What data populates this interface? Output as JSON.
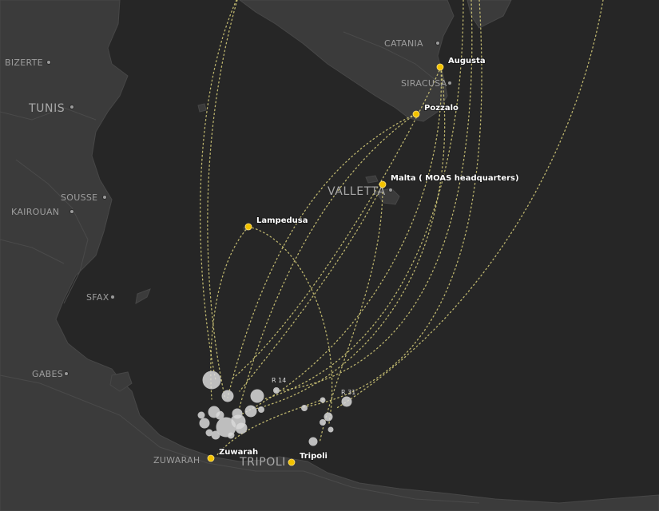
{
  "city_labels": [
    {
      "id": "bizerte",
      "text": "BIZERTE"
    },
    {
      "id": "tunis",
      "text": "TUNIS"
    },
    {
      "id": "sousse",
      "text": "SOUSSE"
    },
    {
      "id": "kairouan",
      "text": "KAIROUAN"
    },
    {
      "id": "sfax",
      "text": "SFAX"
    },
    {
      "id": "gabes",
      "text": "GABES"
    },
    {
      "id": "zuwarah",
      "text": "ZUWARAH"
    },
    {
      "id": "tripoli",
      "text": "TRIPOLI"
    },
    {
      "id": "catania",
      "text": "CATANIA"
    },
    {
      "id": "siracusa",
      "text": "SIRACUSA"
    },
    {
      "id": "valletta",
      "text": "VALLETTA"
    }
  ],
  "ports": [
    {
      "id": "augusta",
      "label": "Augusta"
    },
    {
      "id": "pozzalo",
      "label": "Pozzalo"
    },
    {
      "id": "malta",
      "label": "Malta ( MOAS headquarters)"
    },
    {
      "id": "lampedusa",
      "label": "Lampedusa"
    },
    {
      "id": "zuwarah",
      "label": "Zuwarah"
    },
    {
      "id": "tripoli",
      "label": "Tripoli"
    }
  ],
  "rescue_labels": [
    {
      "id": "r14",
      "text": "R 14"
    },
    {
      "id": "r31",
      "text": "R 31"
    }
  ],
  "colors": {
    "sea": "#262626",
    "land": "#3b3b3b",
    "route": "#d8cf7a",
    "port": "#f2c200",
    "bubble": "#d9d9d9"
  }
}
